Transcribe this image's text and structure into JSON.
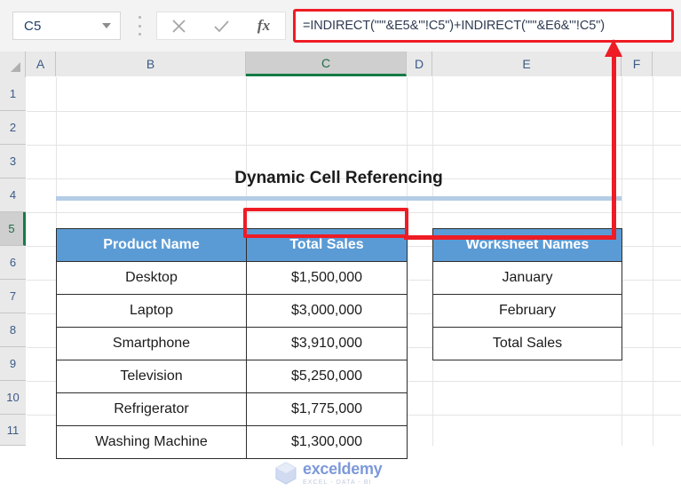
{
  "formula_bar": {
    "name_box_value": "C5",
    "name_box_placeholder": "Name Box",
    "dropdown_icon": "chevron-down-icon",
    "separator_icon": "vertical-dots-icon",
    "cancel_icon": "close-icon",
    "confirm_icon": "check-icon",
    "function_icon": "fx-icon",
    "function_label": "fx",
    "formula": "=INDIRECT(\"'\"&E5&\"'!C5\")+INDIRECT(\"'\"&E6&\"'!C5\")"
  },
  "grid": {
    "columns": [
      "A",
      "B",
      "C",
      "D",
      "E",
      "F"
    ],
    "active_column": "C",
    "rows": [
      "1",
      "2",
      "3",
      "4",
      "5",
      "6",
      "7",
      "8",
      "9",
      "10",
      "11"
    ],
    "active_row": "5",
    "select_all_icon": "select-all-corner-icon"
  },
  "sheet": {
    "title": "Dynamic Cell Referencing",
    "left_table": {
      "headers": [
        "Product Name",
        "Total Sales"
      ],
      "rows": [
        {
          "product": "Desktop",
          "sales": "$1,500,000"
        },
        {
          "product": "Laptop",
          "sales": "$3,000,000"
        },
        {
          "product": "Smartphone",
          "sales": "$3,910,000"
        },
        {
          "product": "Television",
          "sales": "$5,250,000"
        },
        {
          "product": "Refrigerator",
          "sales": "$1,775,000"
        },
        {
          "product": "Washing Machine",
          "sales": "$1,300,000"
        }
      ]
    },
    "right_table": {
      "header": "Worksheet Names",
      "rows": [
        {
          "name": "January"
        },
        {
          "name": "February"
        },
        {
          "name": "Total Sales"
        }
      ]
    }
  },
  "annotation": {
    "highlight_target": "C5",
    "arrow_icon": "up-arrow-annotation-icon",
    "color": "#ee1c25"
  },
  "watermark": {
    "brand": "exceldemy",
    "tagline": "EXCEL - DATA - BI",
    "logo_icon": "exceldemy-logo-icon"
  },
  "colors": {
    "header_blue": "#5b9bd5",
    "title_rule_blue": "#b5cce6",
    "annotation_red": "#ee1c25",
    "active_green": "#147b45"
  }
}
